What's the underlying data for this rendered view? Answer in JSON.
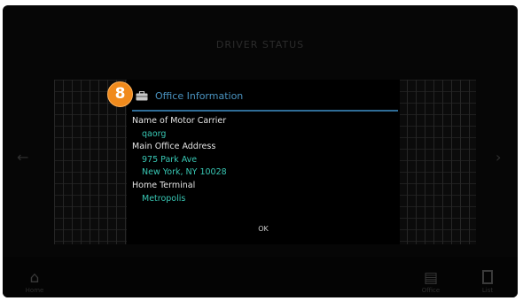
{
  "background": {
    "title": "DRIVER STATUS",
    "left_arrow_icon": "chevron-left-icon",
    "right_arrow_icon": "chevron-right-icon"
  },
  "bottom_bar": {
    "home": {
      "icon": "home-icon",
      "label": "Home"
    },
    "office": {
      "icon": "briefcase-icon",
      "label": "Office"
    },
    "list": {
      "icon": "list-icon",
      "label": "List"
    }
  },
  "step_badge": "8",
  "dialog": {
    "icon": "briefcase-icon",
    "title": "Office Information",
    "fields": [
      {
        "label": "Name of Motor Carrier",
        "values": [
          "qaorg"
        ]
      },
      {
        "label": "Main Office Address",
        "values": [
          "975 Park Ave",
          "New York, NY 10028"
        ]
      },
      {
        "label": "Home Terminal",
        "values": [
          "Metropolis"
        ]
      }
    ],
    "ok_label": "OK"
  },
  "colors": {
    "screen_background": "#060606",
    "title_accent": "#4a93c0",
    "value_text": "#38c7b4",
    "badge": "#f08a1c"
  }
}
